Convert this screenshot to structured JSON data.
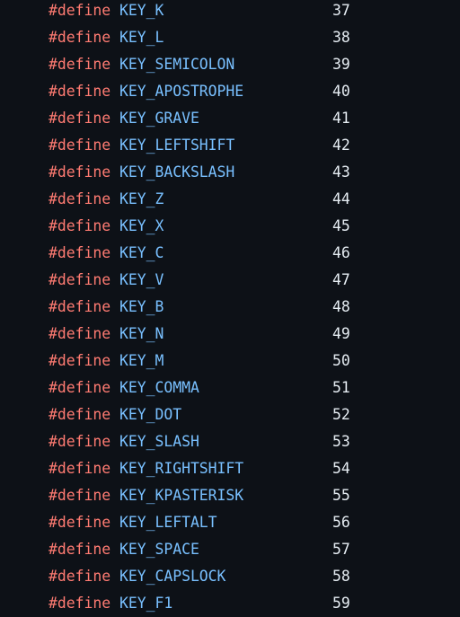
{
  "code": {
    "keyword": "#define",
    "lines": [
      {
        "name": "KEY_K",
        "value": "37"
      },
      {
        "name": "KEY_L",
        "value": "38"
      },
      {
        "name": "KEY_SEMICOLON",
        "value": "39"
      },
      {
        "name": "KEY_APOSTROPHE",
        "value": "40"
      },
      {
        "name": "KEY_GRAVE",
        "value": "41"
      },
      {
        "name": "KEY_LEFTSHIFT",
        "value": "42"
      },
      {
        "name": "KEY_BACKSLASH",
        "value": "43"
      },
      {
        "name": "KEY_Z",
        "value": "44"
      },
      {
        "name": "KEY_X",
        "value": "45"
      },
      {
        "name": "KEY_C",
        "value": "46"
      },
      {
        "name": "KEY_V",
        "value": "47"
      },
      {
        "name": "KEY_B",
        "value": "48"
      },
      {
        "name": "KEY_N",
        "value": "49"
      },
      {
        "name": "KEY_M",
        "value": "50"
      },
      {
        "name": "KEY_COMMA",
        "value": "51"
      },
      {
        "name": "KEY_DOT",
        "value": "52"
      },
      {
        "name": "KEY_SLASH",
        "value": "53"
      },
      {
        "name": "KEY_RIGHTSHIFT",
        "value": "54"
      },
      {
        "name": "KEY_KPASTERISK",
        "value": "55"
      },
      {
        "name": "KEY_LEFTALT",
        "value": "56"
      },
      {
        "name": "KEY_SPACE",
        "value": "57"
      },
      {
        "name": "KEY_CAPSLOCK",
        "value": "58"
      },
      {
        "name": "KEY_F1",
        "value": "59"
      }
    ]
  },
  "colors": {
    "background": "#0d1117",
    "keyword": "#ff7b72",
    "identifier": "#79c0ff",
    "number": "#e6edf3"
  }
}
